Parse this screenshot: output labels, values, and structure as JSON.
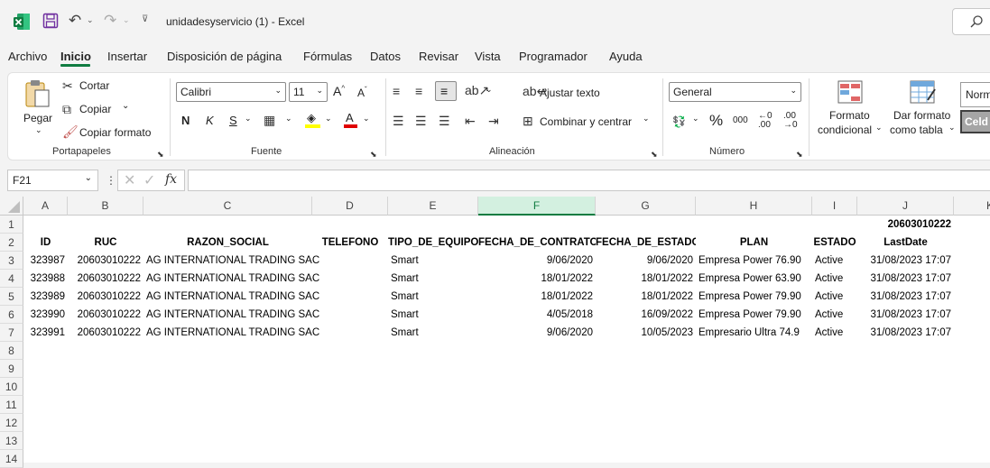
{
  "title": {
    "filename": "unidadesyservicio (1)",
    "separator": "-",
    "app": "Excel"
  },
  "menu": [
    "Archivo",
    "Inicio",
    "Insertar",
    "Disposición de página",
    "Fórmulas",
    "Datos",
    "Revisar",
    "Vista",
    "Programador",
    "Ayuda"
  ],
  "ribbon": {
    "clipboard": {
      "paste": "Pegar",
      "cut": "Cortar",
      "copy": "Copiar",
      "format_painter": "Copiar formato",
      "label": "Portapapeles"
    },
    "font": {
      "name": "Calibri",
      "size": "11",
      "bold": "N",
      "italic": "K",
      "underline": "S",
      "label": "Fuente"
    },
    "alignment": {
      "wrap": "Ajustar texto",
      "merge": "Combinar y centrar",
      "label": "Alineación"
    },
    "number": {
      "format": "General",
      "percent": "%",
      "thousands": "000",
      "label": "Número"
    },
    "styles": {
      "conditional_1": "Formato",
      "conditional_2": "condicional",
      "table_1": "Dar formato",
      "table_2": "como tabla",
      "normal": "Norm",
      "celda": "Celd"
    }
  },
  "formula_bar": {
    "name_box": "F21",
    "fx": "fx",
    "value": ""
  },
  "columns": [
    "A",
    "B",
    "C",
    "D",
    "E",
    "F",
    "G",
    "H",
    "I",
    "J",
    "K"
  ],
  "rows": [
    "1",
    "2",
    "3",
    "4",
    "5",
    "6",
    "7",
    "8",
    "9",
    "10",
    "11",
    "12",
    "13",
    "14"
  ],
  "sheet": {
    "j1": "20603010222",
    "headers": [
      "ID",
      "RUC",
      "RAZON_SOCIAL",
      "TELEFONO",
      "TIPO_DE_EQUIPO",
      "FECHA_DE_CONTRATO",
      "FECHA_DE_ESTADO",
      "PLAN",
      "ESTADO",
      "LastDate"
    ],
    "data": [
      [
        "323987",
        "20603010222",
        "AG INTERNATIONAL TRADING SAC",
        "",
        "Smart",
        "9/06/2020",
        "9/06/2020",
        "Empresa Power 76.90",
        "Active",
        "31/08/2023 17:07"
      ],
      [
        "323988",
        "20603010222",
        "AG INTERNATIONAL TRADING SAC",
        "",
        "Smart",
        "18/01/2022",
        "18/01/2022",
        "Empresa Power 63.90",
        "Active",
        "31/08/2023 17:07"
      ],
      [
        "323989",
        "20603010222",
        "AG INTERNATIONAL TRADING SAC",
        "",
        "Smart",
        "18/01/2022",
        "18/01/2022",
        "Empresa Power 79.90",
        "Active",
        "31/08/2023 17:07"
      ],
      [
        "323990",
        "20603010222",
        "AG INTERNATIONAL TRADING SAC",
        "",
        "Smart",
        "4/05/2018",
        "16/09/2022",
        "Empresa Power 79.90",
        "Active",
        "31/08/2023 17:07"
      ],
      [
        "323991",
        "20603010222",
        "AG INTERNATIONAL TRADING SAC",
        "",
        "Smart",
        "9/06/2020",
        "10/05/2023",
        "Empresario Ultra 74.9",
        "Active",
        "31/08/2023 17:07"
      ]
    ]
  },
  "colors": {
    "excel_green": "#107c41",
    "selected_header_bg": "#d3f0e0"
  }
}
